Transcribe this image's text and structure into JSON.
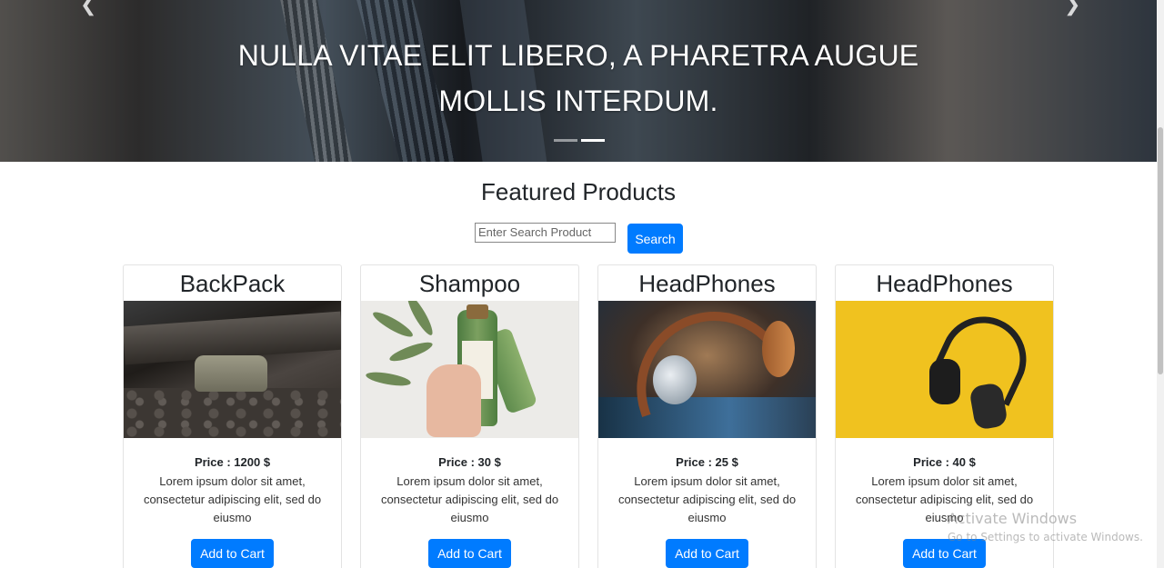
{
  "carousel": {
    "caption": "Nulla vitae elit libero, a pharetra augue mollis interdum.",
    "prev_icon": "chevron-left-icon",
    "next_icon": "chevron-right-icon",
    "slides": 2,
    "active_slide": 2
  },
  "section": {
    "title": "Featured Products"
  },
  "search": {
    "placeholder": "Enter Search Product",
    "value": "",
    "button_label": "Search"
  },
  "products": [
    {
      "name": "BackPack",
      "price": "Price : 1200 $",
      "description": "Lorem ipsum dolor sit amet, consectetur adipiscing elit, sed do eiusmo",
      "button_label": "Add to Cart"
    },
    {
      "name": "Shampoo",
      "price": "Price : 30 $",
      "description": "Lorem ipsum dolor sit amet, consectetur adipiscing elit, sed do eiusmo",
      "button_label": "Add to Cart"
    },
    {
      "name": "HeadPhones",
      "price": "Price : 25 $",
      "description": "Lorem ipsum dolor sit amet, consectetur adipiscing elit, sed do eiusmo",
      "button_label": "Add to Cart"
    },
    {
      "name": "HeadPhones",
      "price": "Price : 40 $",
      "description": "Lorem ipsum dolor sit amet, consectetur adipiscing elit, sed do eiusmo",
      "button_label": "Add to Cart"
    }
  ],
  "watermark": {
    "title": "Activate Windows",
    "subtitle": "Go to Settings to activate Windows."
  },
  "colors": {
    "primary": "#007bff",
    "text": "#212529"
  }
}
